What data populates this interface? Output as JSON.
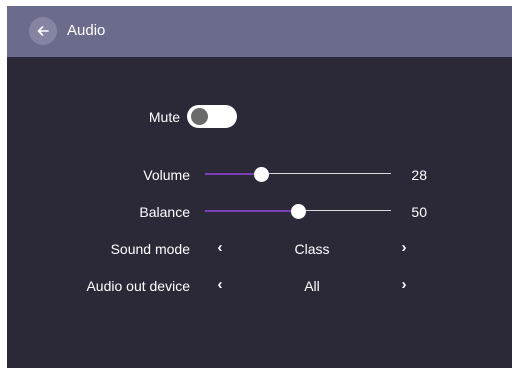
{
  "header": {
    "title": "Audio",
    "back_icon": "arrow-left-icon"
  },
  "mute": {
    "label": "Mute",
    "on": false
  },
  "volume": {
    "label": "Volume",
    "value": "28",
    "fraction": 0.3
  },
  "balance": {
    "label": "Balance",
    "value": "50",
    "fraction": 0.5
  },
  "sound_mode": {
    "label": "Sound mode",
    "value": "Class",
    "prev_glyph": "‹",
    "next_glyph": "›"
  },
  "audio_out": {
    "label": "Audio out device",
    "value": "All",
    "prev_glyph": "‹",
    "next_glyph": "›"
  },
  "colors": {
    "panel_bg": "#2b2838",
    "header_bg": "#6b6b8b",
    "accent": "#7b3fb8"
  }
}
